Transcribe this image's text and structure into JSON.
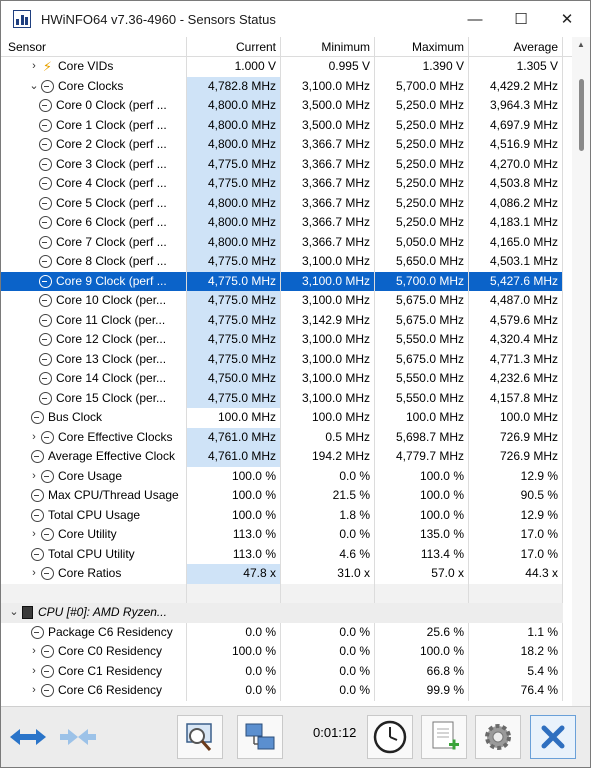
{
  "window": {
    "title": "HWiNFO64 v7.36-4960 - Sensors Status",
    "minimize_glyph": "—",
    "maximize_glyph": "☐",
    "close_glyph": "✕"
  },
  "table": {
    "headers": [
      "Sensor",
      "Current",
      "Minimum",
      "Maximum",
      "Average"
    ],
    "rows": [
      {
        "label": "Core VIDs",
        "indent": 1,
        "chev": "›",
        "icon": "bolt",
        "current": "1.000 V",
        "min": "0.995 V",
        "max": "1.390 V",
        "avg": "1.305 V",
        "hl": false
      },
      {
        "label": "Core Clocks",
        "indent": 1,
        "chev": "⌄",
        "icon": "clock",
        "current": "4,782.8 MHz",
        "min": "3,100.0 MHz",
        "max": "5,700.0 MHz",
        "avg": "4,429.2 MHz",
        "hl": true,
        "shade": true
      },
      {
        "label": "Core 0 Clock (perf ...",
        "indent": 2,
        "chev": "",
        "icon": "clock",
        "current": "4,800.0 MHz",
        "min": "3,500.0 MHz",
        "max": "5,250.0 MHz",
        "avg": "3,964.3 MHz",
        "hl": true
      },
      {
        "label": "Core 1 Clock (perf ...",
        "indent": 2,
        "chev": "",
        "icon": "clock",
        "current": "4,800.0 MHz",
        "min": "3,500.0 MHz",
        "max": "5,250.0 MHz",
        "avg": "4,697.9 MHz",
        "hl": true
      },
      {
        "label": "Core 2 Clock (perf ...",
        "indent": 2,
        "chev": "",
        "icon": "clock",
        "current": "4,800.0 MHz",
        "min": "3,366.7 MHz",
        "max": "5,250.0 MHz",
        "avg": "4,516.9 MHz",
        "hl": true
      },
      {
        "label": "Core 3 Clock (perf ...",
        "indent": 2,
        "chev": "",
        "icon": "clock",
        "current": "4,775.0 MHz",
        "min": "3,366.7 MHz",
        "max": "5,250.0 MHz",
        "avg": "4,270.0 MHz",
        "hl": true
      },
      {
        "label": "Core 4 Clock (perf ...",
        "indent": 2,
        "chev": "",
        "icon": "clock",
        "current": "4,775.0 MHz",
        "min": "3,366.7 MHz",
        "max": "5,250.0 MHz",
        "avg": "4,503.8 MHz",
        "hl": true
      },
      {
        "label": "Core 5 Clock (perf ...",
        "indent": 2,
        "chev": "",
        "icon": "clock",
        "current": "4,800.0 MHz",
        "min": "3,366.7 MHz",
        "max": "5,250.0 MHz",
        "avg": "4,086.2 MHz",
        "hl": true
      },
      {
        "label": "Core 6 Clock (perf ...",
        "indent": 2,
        "chev": "",
        "icon": "clock",
        "current": "4,800.0 MHz",
        "min": "3,366.7 MHz",
        "max": "5,250.0 MHz",
        "avg": "4,183.1 MHz",
        "hl": true
      },
      {
        "label": "Core 7 Clock (perf ...",
        "indent": 2,
        "chev": "",
        "icon": "clock",
        "current": "4,800.0 MHz",
        "min": "3,366.7 MHz",
        "max": "5,050.0 MHz",
        "avg": "4,165.0 MHz",
        "hl": true
      },
      {
        "label": "Core 8 Clock (perf ...",
        "indent": 2,
        "chev": "",
        "icon": "clock",
        "current": "4,775.0 MHz",
        "min": "3,100.0 MHz",
        "max": "5,650.0 MHz",
        "avg": "4,503.1 MHz",
        "hl": true
      },
      {
        "label": "Core 9 Clock (perf ...",
        "indent": 2,
        "chev": "",
        "icon": "clock",
        "current": "4,775.0 MHz",
        "min": "3,100.0 MHz",
        "max": "5,700.0 MHz",
        "avg": "5,427.6 MHz",
        "hl": true,
        "selected": true
      },
      {
        "label": "Core 10 Clock (per...",
        "indent": 2,
        "chev": "",
        "icon": "clock",
        "current": "4,775.0 MHz",
        "min": "3,100.0 MHz",
        "max": "5,675.0 MHz",
        "avg": "4,487.0 MHz",
        "hl": true
      },
      {
        "label": "Core 11 Clock (per...",
        "indent": 2,
        "chev": "",
        "icon": "clock",
        "current": "4,775.0 MHz",
        "min": "3,142.9 MHz",
        "max": "5,675.0 MHz",
        "avg": "4,579.6 MHz",
        "hl": true
      },
      {
        "label": "Core 12 Clock (per...",
        "indent": 2,
        "chev": "",
        "icon": "clock",
        "current": "4,775.0 MHz",
        "min": "3,100.0 MHz",
        "max": "5,550.0 MHz",
        "avg": "4,320.4 MHz",
        "hl": true
      },
      {
        "label": "Core 13 Clock (per...",
        "indent": 2,
        "chev": "",
        "icon": "clock",
        "current": "4,775.0 MHz",
        "min": "3,100.0 MHz",
        "max": "5,675.0 MHz",
        "avg": "4,771.3 MHz",
        "hl": true
      },
      {
        "label": "Core 14 Clock (per...",
        "indent": 2,
        "chev": "",
        "icon": "clock",
        "current": "4,750.0 MHz",
        "min": "3,100.0 MHz",
        "max": "5,550.0 MHz",
        "avg": "4,232.6 MHz",
        "hl": true
      },
      {
        "label": "Core 15 Clock (per...",
        "indent": 2,
        "chev": "",
        "icon": "clock",
        "current": "4,775.0 MHz",
        "min": "3,100.0 MHz",
        "max": "5,550.0 MHz",
        "avg": "4,157.8 MHz",
        "hl": true
      },
      {
        "label": "Bus Clock",
        "indent": 0,
        "chev": "",
        "icon": "clock",
        "current": "100.0 MHz",
        "min": "100.0 MHz",
        "max": "100.0 MHz",
        "avg": "100.0 MHz",
        "hl": false
      },
      {
        "label": "Core Effective Clocks",
        "indent": 1,
        "chev": "›",
        "icon": "clock",
        "current": "4,761.0 MHz",
        "min": "0.5 MHz",
        "max": "5,698.7 MHz",
        "avg": "726.9 MHz",
        "hl": true
      },
      {
        "label": "Average Effective Clock",
        "indent": 0,
        "chev": "",
        "icon": "clock",
        "current": "4,761.0 MHz",
        "min": "194.2 MHz",
        "max": "4,779.7 MHz",
        "avg": "726.9 MHz",
        "hl": true
      },
      {
        "label": "Core Usage",
        "indent": 1,
        "chev": "›",
        "icon": "clock",
        "current": "100.0 %",
        "min": "0.0 %",
        "max": "100.0 %",
        "avg": "12.9 %",
        "hl": false
      },
      {
        "label": "Max CPU/Thread Usage",
        "indent": 0,
        "chev": "",
        "icon": "clock",
        "current": "100.0 %",
        "min": "21.5 %",
        "max": "100.0 %",
        "avg": "90.5 %",
        "hl": false
      },
      {
        "label": "Total CPU Usage",
        "indent": 0,
        "chev": "",
        "icon": "clock",
        "current": "100.0 %",
        "min": "1.8 %",
        "max": "100.0 %",
        "avg": "12.9 %",
        "hl": false
      },
      {
        "label": "Core Utility",
        "indent": 1,
        "chev": "›",
        "icon": "clock",
        "current": "113.0 %",
        "min": "0.0 %",
        "max": "135.0 %",
        "avg": "17.0 %",
        "hl": false
      },
      {
        "label": "Total CPU Utility",
        "indent": 0,
        "chev": "",
        "icon": "clock",
        "current": "113.0 %",
        "min": "4.6 %",
        "max": "113.4 %",
        "avg": "17.0 %",
        "hl": false
      },
      {
        "label": "Core Ratios",
        "indent": 1,
        "chev": "›",
        "icon": "clock",
        "current": "47.8 x",
        "min": "31.0 x",
        "max": "57.0 x",
        "avg": "44.3 x",
        "hl": true
      },
      {
        "blank": true
      },
      {
        "label": "CPU [#0]: AMD Ryzen...",
        "indent": 0,
        "chev": "⌄",
        "icon": "chip",
        "group": true,
        "current": "",
        "min": "",
        "max": "",
        "avg": ""
      },
      {
        "label": "Package C6 Residency",
        "indent": 0,
        "chev": "",
        "icon": "clock",
        "current": "0.0 %",
        "min": "0.0 %",
        "max": "25.6 %",
        "avg": "1.1 %",
        "hl": false
      },
      {
        "label": "Core C0 Residency",
        "indent": 1,
        "chev": "›",
        "icon": "clock",
        "current": "100.0 %",
        "min": "0.0 %",
        "max": "100.0 %",
        "avg": "18.2 %",
        "hl": false
      },
      {
        "label": "Core C1 Residency",
        "indent": 1,
        "chev": "›",
        "icon": "clock",
        "current": "0.0 %",
        "min": "0.0 %",
        "max": "66.8 %",
        "avg": "5.4 %",
        "hl": false
      },
      {
        "label": "Core C6 Residency",
        "indent": 1,
        "chev": "›",
        "icon": "clock",
        "current": "0.0 %",
        "min": "0.0 %",
        "max": "99.9 %",
        "avg": "76.4 %",
        "hl": false
      }
    ]
  },
  "toolbar": {
    "timer": "0:01:12",
    "icons": [
      "nav-arrows-icon",
      "collapse-arrows-icon",
      "sensor-monitor-icon",
      "network-computers-icon",
      "clock-reset-icon",
      "add-log-icon",
      "settings-gear-icon",
      "close-x-icon"
    ]
  },
  "colors": {
    "selection": "#0b63c9",
    "current_highlight": "#cfe3f7",
    "group_row": "#ededed"
  }
}
